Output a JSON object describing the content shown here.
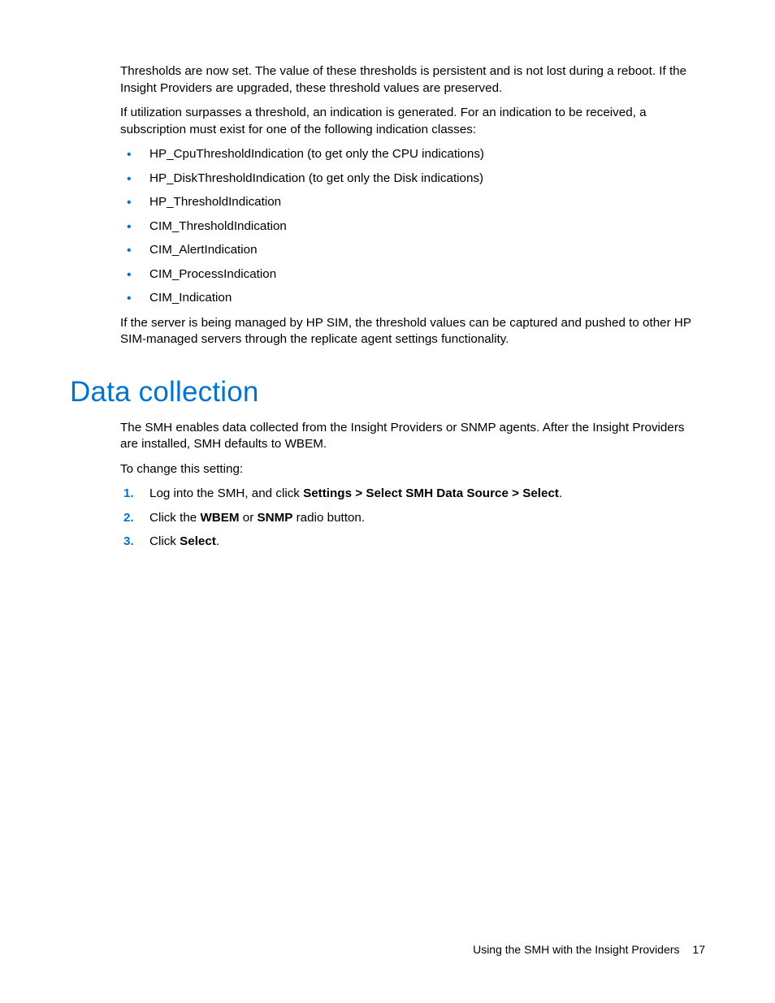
{
  "para1": "Thresholds are now set. The value of these thresholds is persistent and is not lost during a reboot. If the Insight Providers are upgraded, these threshold values are preserved.",
  "para2": "If utilization surpasses a threshold, an indication is generated. For an indication to be received, a subscription must exist for one of the following indication classes:",
  "bullets": [
    "HP_CpuThresholdIndication (to get only the CPU indications)",
    "HP_DiskThresholdIndication (to get only the Disk indications)",
    "HP_ThresholdIndication",
    "CIM_ThresholdIndication",
    "CIM_AlertIndication",
    "CIM_ProcessIndication",
    "CIM_Indication"
  ],
  "para3": "If the server is being managed by HP SIM, the threshold values can be captured and pushed to other HP SIM-managed servers through the replicate agent settings functionality.",
  "heading": "Data collection",
  "para4": "The SMH enables data collected from the Insight Providers or SNMP agents. After the Insight Providers are installed, SMH defaults to WBEM.",
  "para5": "To change this setting:",
  "step1_a": "Log into the SMH, and click ",
  "step1_b": "Settings > Select SMH Data Source > Select",
  "step1_c": ".",
  "step2_a": "Click the ",
  "step2_b": "WBEM",
  "step2_c": " or ",
  "step2_d": "SNMP",
  "step2_e": " radio button.",
  "step3_a": "Click ",
  "step3_b": "Select",
  "step3_c": ".",
  "footer_title": "Using the SMH with the Insight Providers",
  "footer_page": "17"
}
